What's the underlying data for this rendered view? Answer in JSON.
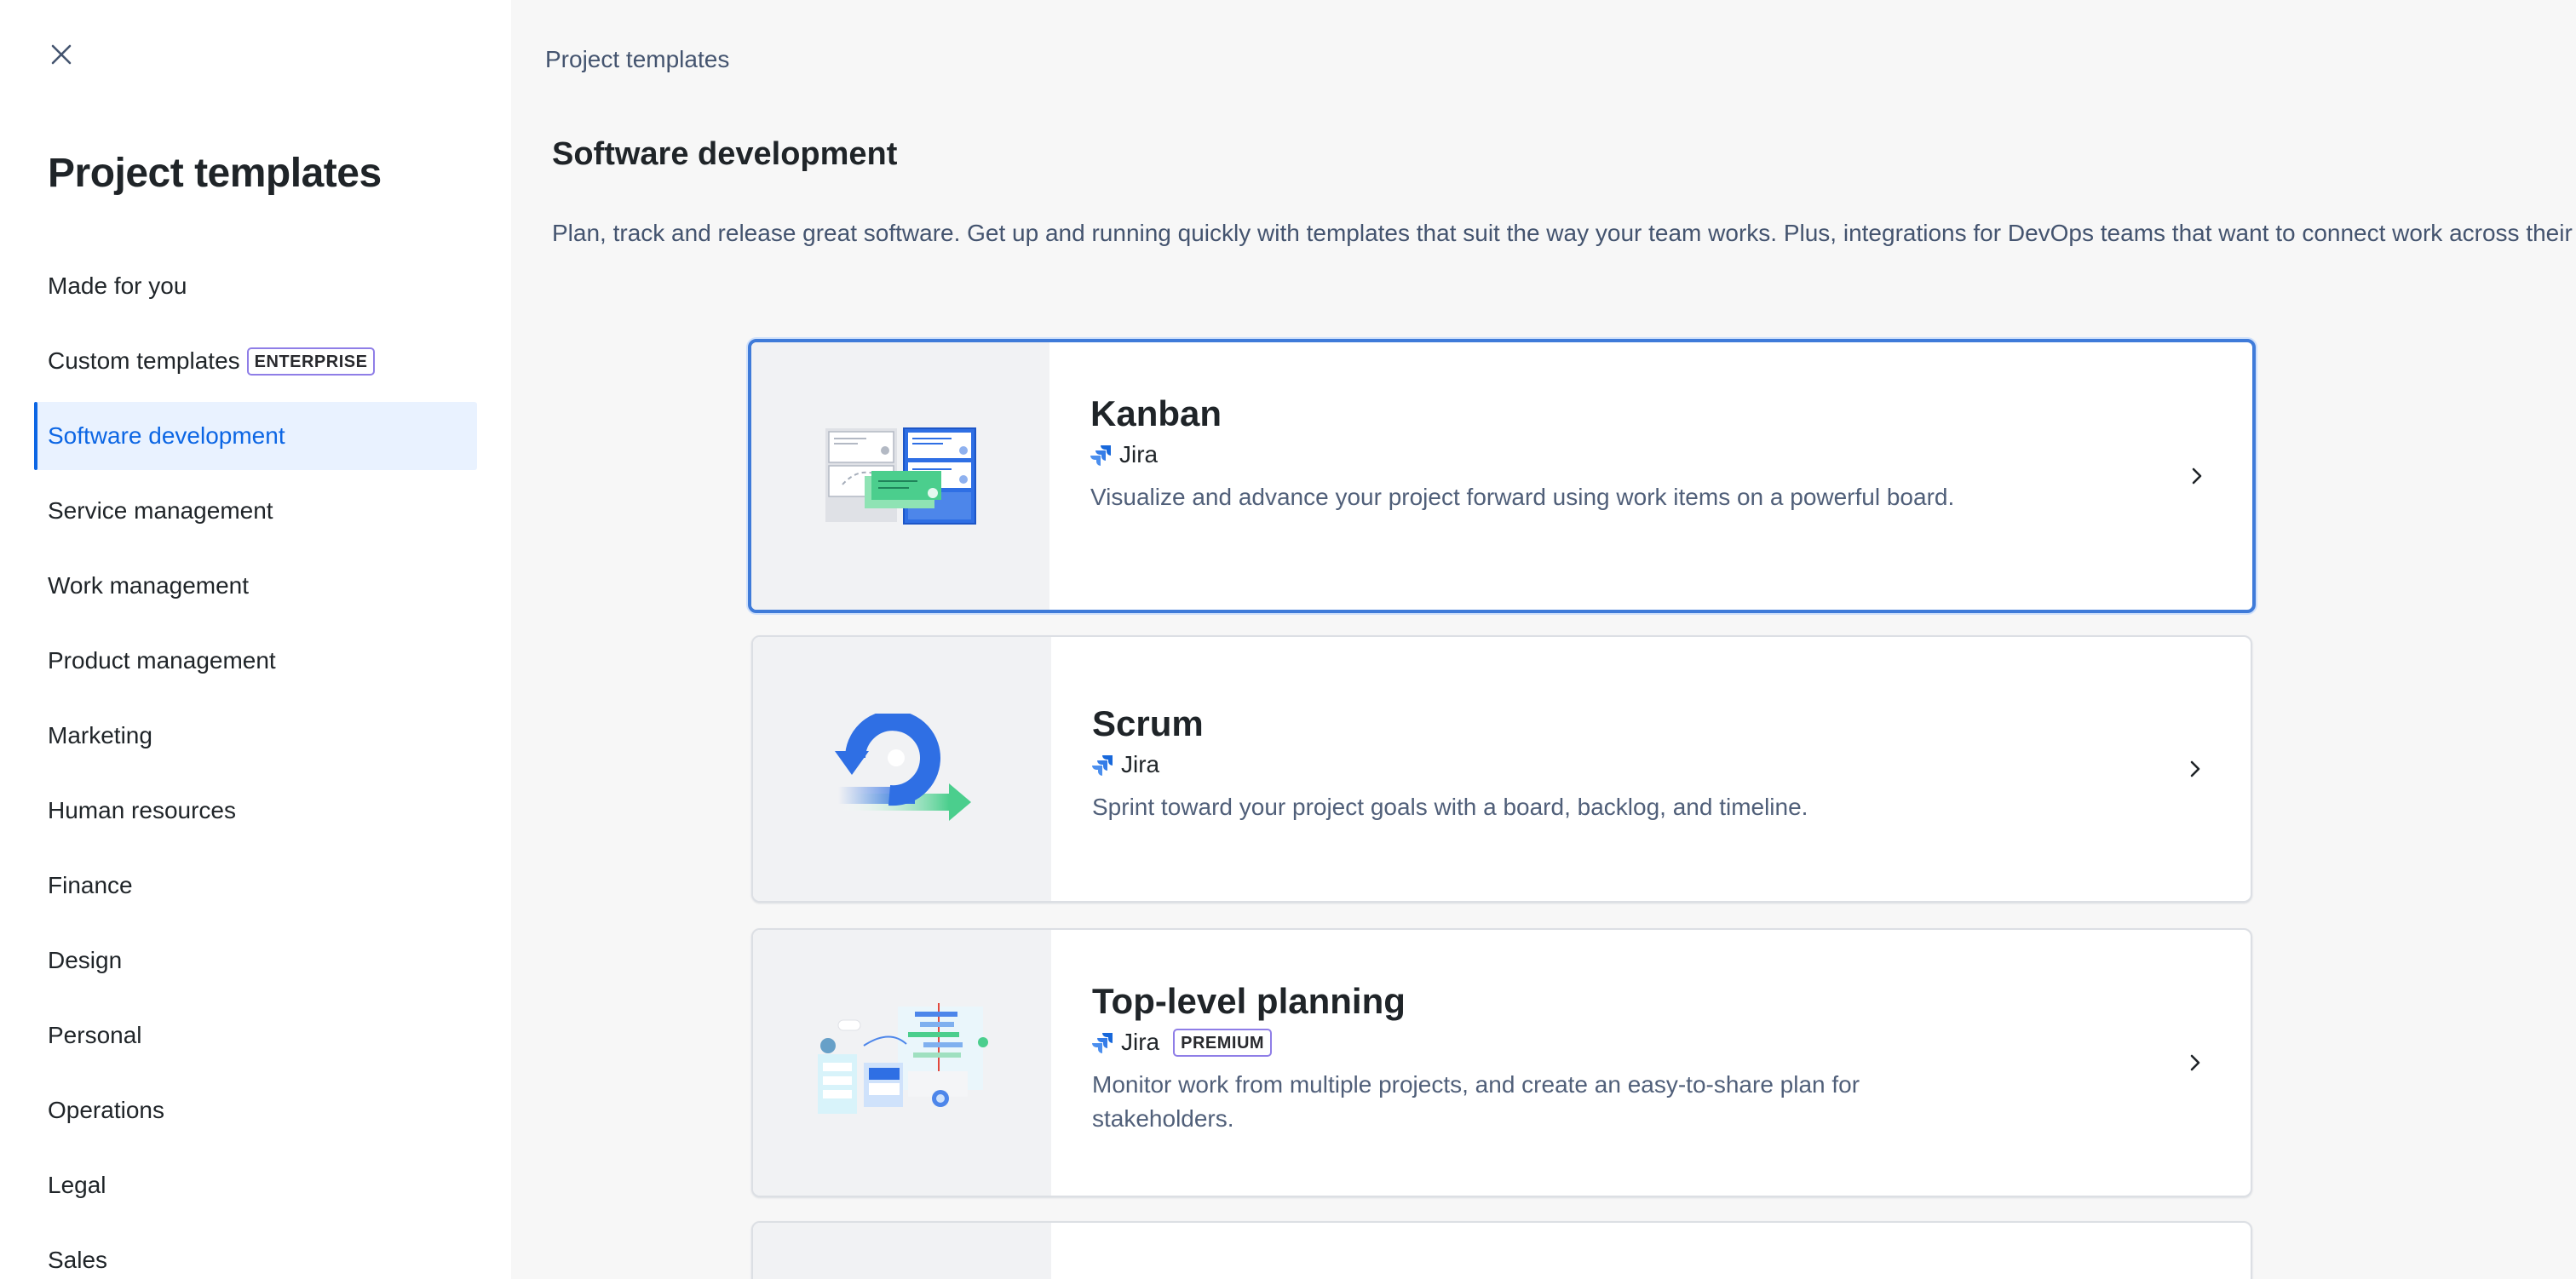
{
  "sidebar": {
    "title": "Project templates",
    "items": [
      {
        "label": "Made for you"
      },
      {
        "label": "Custom templates",
        "badge": "ENTERPRISE"
      },
      {
        "label": "Software development",
        "active": true
      },
      {
        "label": "Service management"
      },
      {
        "label": "Work management"
      },
      {
        "label": "Product management"
      },
      {
        "label": "Marketing"
      },
      {
        "label": "Human resources"
      },
      {
        "label": "Finance"
      },
      {
        "label": "Design"
      },
      {
        "label": "Personal"
      },
      {
        "label": "Operations"
      },
      {
        "label": "Legal"
      },
      {
        "label": "Sales"
      }
    ]
  },
  "main": {
    "breadcrumb": "Project templates",
    "section_title": "Software development",
    "section_description": "Plan, track and release great software. Get up and running quickly with templates that suit the way your team works. Plus, integrations for DevOps teams that want to connect work across their entire toolchain.",
    "templates": [
      {
        "title": "Kanban",
        "product": "Jira",
        "description": "Visualize and advance your project forward using work items on a powerful board.",
        "selected": true
      },
      {
        "title": "Scrum",
        "product": "Jira",
        "description": "Sprint toward your project goals with a board, backlog, and timeline."
      },
      {
        "title": "Top-level planning",
        "product": "Jira",
        "badge": "PREMIUM",
        "description": "Monitor work from multiple projects, and create an easy-to-share plan for stakeholders."
      }
    ]
  },
  "colors": {
    "accent": "#0c66e4",
    "active_bg": "#e9f2ff",
    "selected_border": "#3f7bd9",
    "badge_border": "#8f7ee7",
    "main_bg": "#f7f7f7"
  },
  "icons": [
    "close-icon",
    "jira-icon",
    "chevron-right-icon"
  ]
}
